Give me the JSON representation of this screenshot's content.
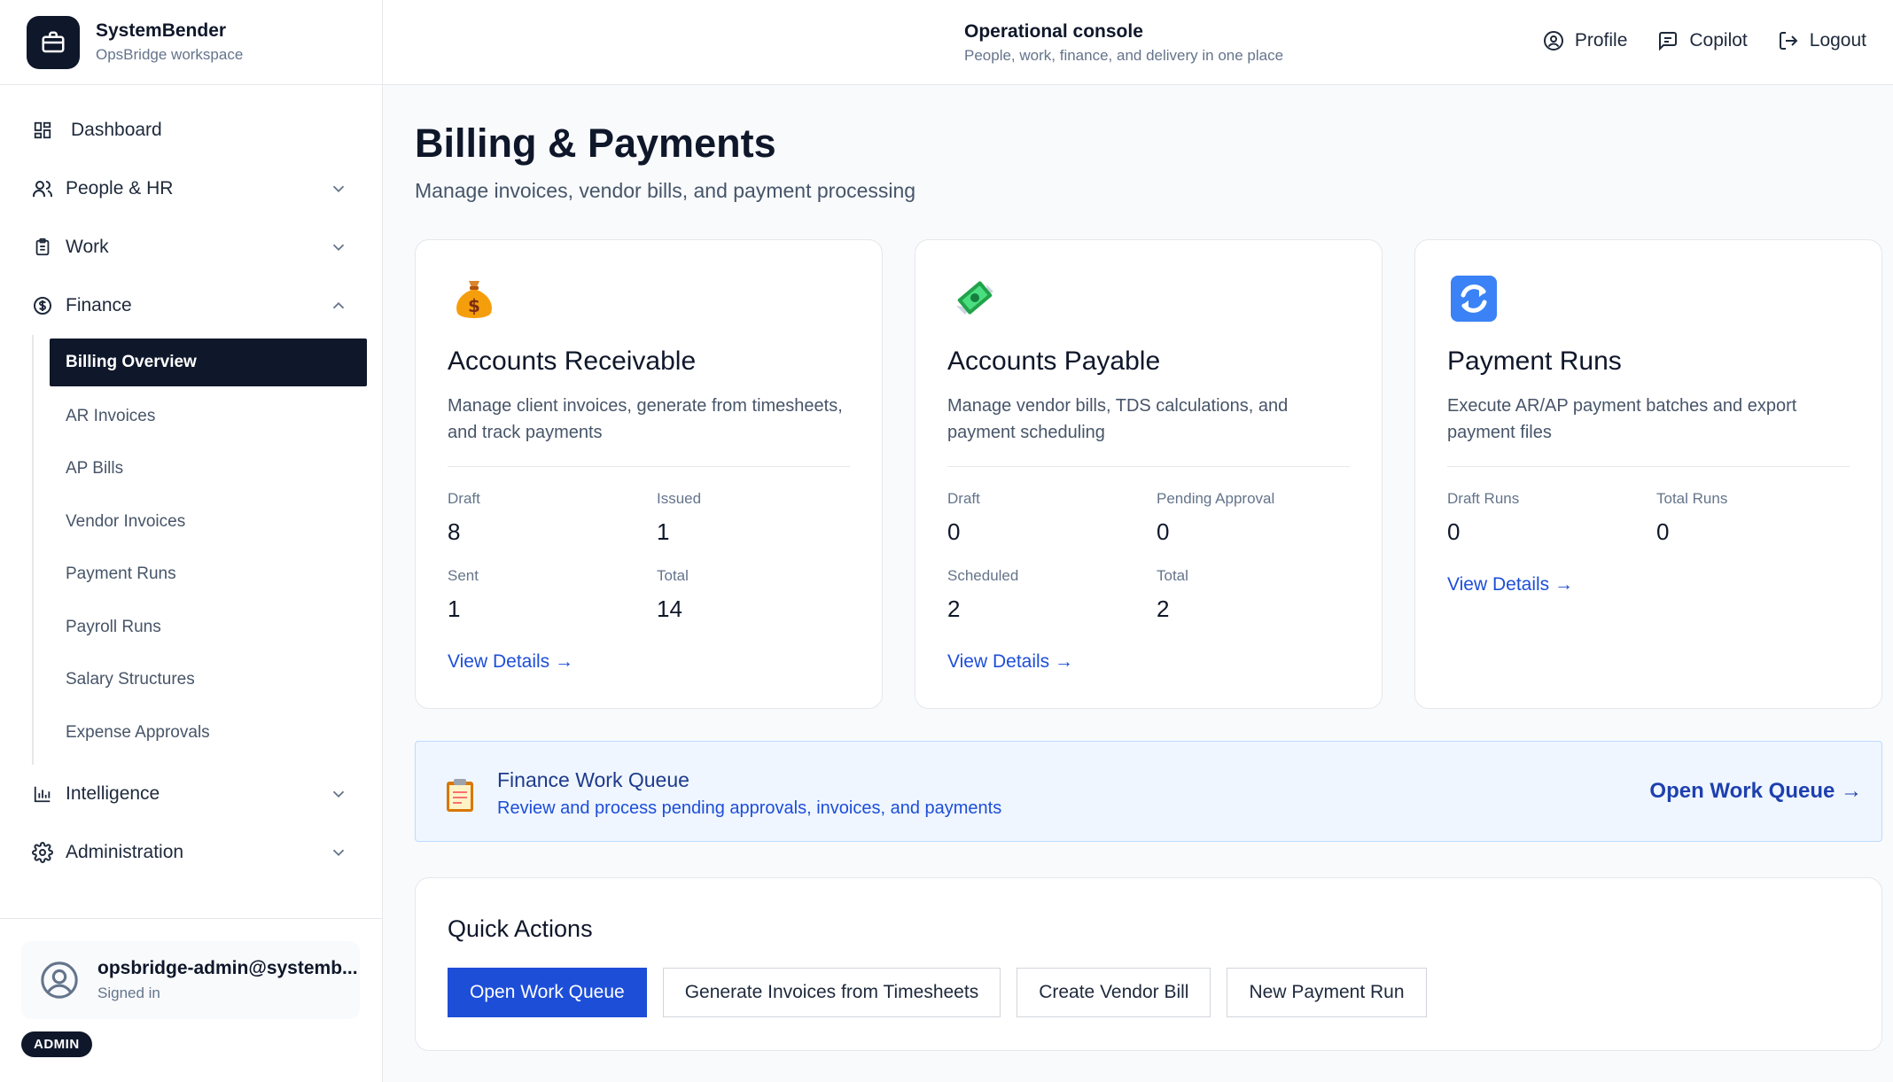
{
  "brand": {
    "name": "SystemBender",
    "workspace": "OpsBridge workspace"
  },
  "header": {
    "title": "Operational console",
    "subtitle": "People, work, finance, and delivery in one place",
    "actions": {
      "profile": "Profile",
      "copilot": "Copilot",
      "logout": "Logout"
    }
  },
  "sidebar": {
    "dashboard": "Dashboard",
    "people": "People & HR",
    "work": "Work",
    "finance": "Finance",
    "finance_items": [
      "Billing Overview",
      "AR Invoices",
      "AP Bills",
      "Vendor Invoices",
      "Payment Runs",
      "Payroll Runs",
      "Salary Structures",
      "Expense Approvals"
    ],
    "intelligence": "Intelligence",
    "administration": "Administration"
  },
  "user": {
    "email": "opsbridge-admin@systemb...",
    "status": "Signed in",
    "role": "ADMIN"
  },
  "page": {
    "title": "Billing & Payments",
    "subtitle": "Manage invoices, vendor bills, and payment processing"
  },
  "cards": {
    "ar": {
      "icon": "money-bag-icon",
      "title": "Accounts Receivable",
      "desc": "Manage client invoices, generate from timesheets, and track payments",
      "stats": [
        {
          "label": "Draft",
          "value": "8"
        },
        {
          "label": "Issued",
          "value": "1"
        },
        {
          "label": "Sent",
          "value": "1"
        },
        {
          "label": "Total",
          "value": "14"
        }
      ],
      "link": "View Details →"
    },
    "ap": {
      "icon": "money-with-wings-icon",
      "title": "Accounts Payable",
      "desc": "Manage vendor bills, TDS calculations, and payment scheduling",
      "stats": [
        {
          "label": "Draft",
          "value": "0"
        },
        {
          "label": "Pending Approval",
          "value": "0"
        },
        {
          "label": "Scheduled",
          "value": "2"
        },
        {
          "label": "Total",
          "value": "2"
        }
      ],
      "link": "View Details →"
    },
    "runs": {
      "icon": "refresh-arrows-icon",
      "title": "Payment Runs",
      "desc": "Execute AR/AP payment batches and export payment files",
      "stats": [
        {
          "label": "Draft Runs",
          "value": "0"
        },
        {
          "label": "Total Runs",
          "value": "0"
        }
      ],
      "link": "View Details →"
    }
  },
  "queue": {
    "title": "Finance Work Queue",
    "subtitle": "Review and process pending approvals, invoices, and payments",
    "link": "Open Work Queue →"
  },
  "quick_actions": {
    "title": "Quick Actions",
    "buttons": [
      "Open Work Queue",
      "Generate Invoices from Timesheets",
      "Create Vendor Bill",
      "New Payment Run"
    ]
  },
  "colors": {
    "primary": "#1d4ed8",
    "dark": "#0f172a",
    "queue_bg": "#eff6ff"
  }
}
